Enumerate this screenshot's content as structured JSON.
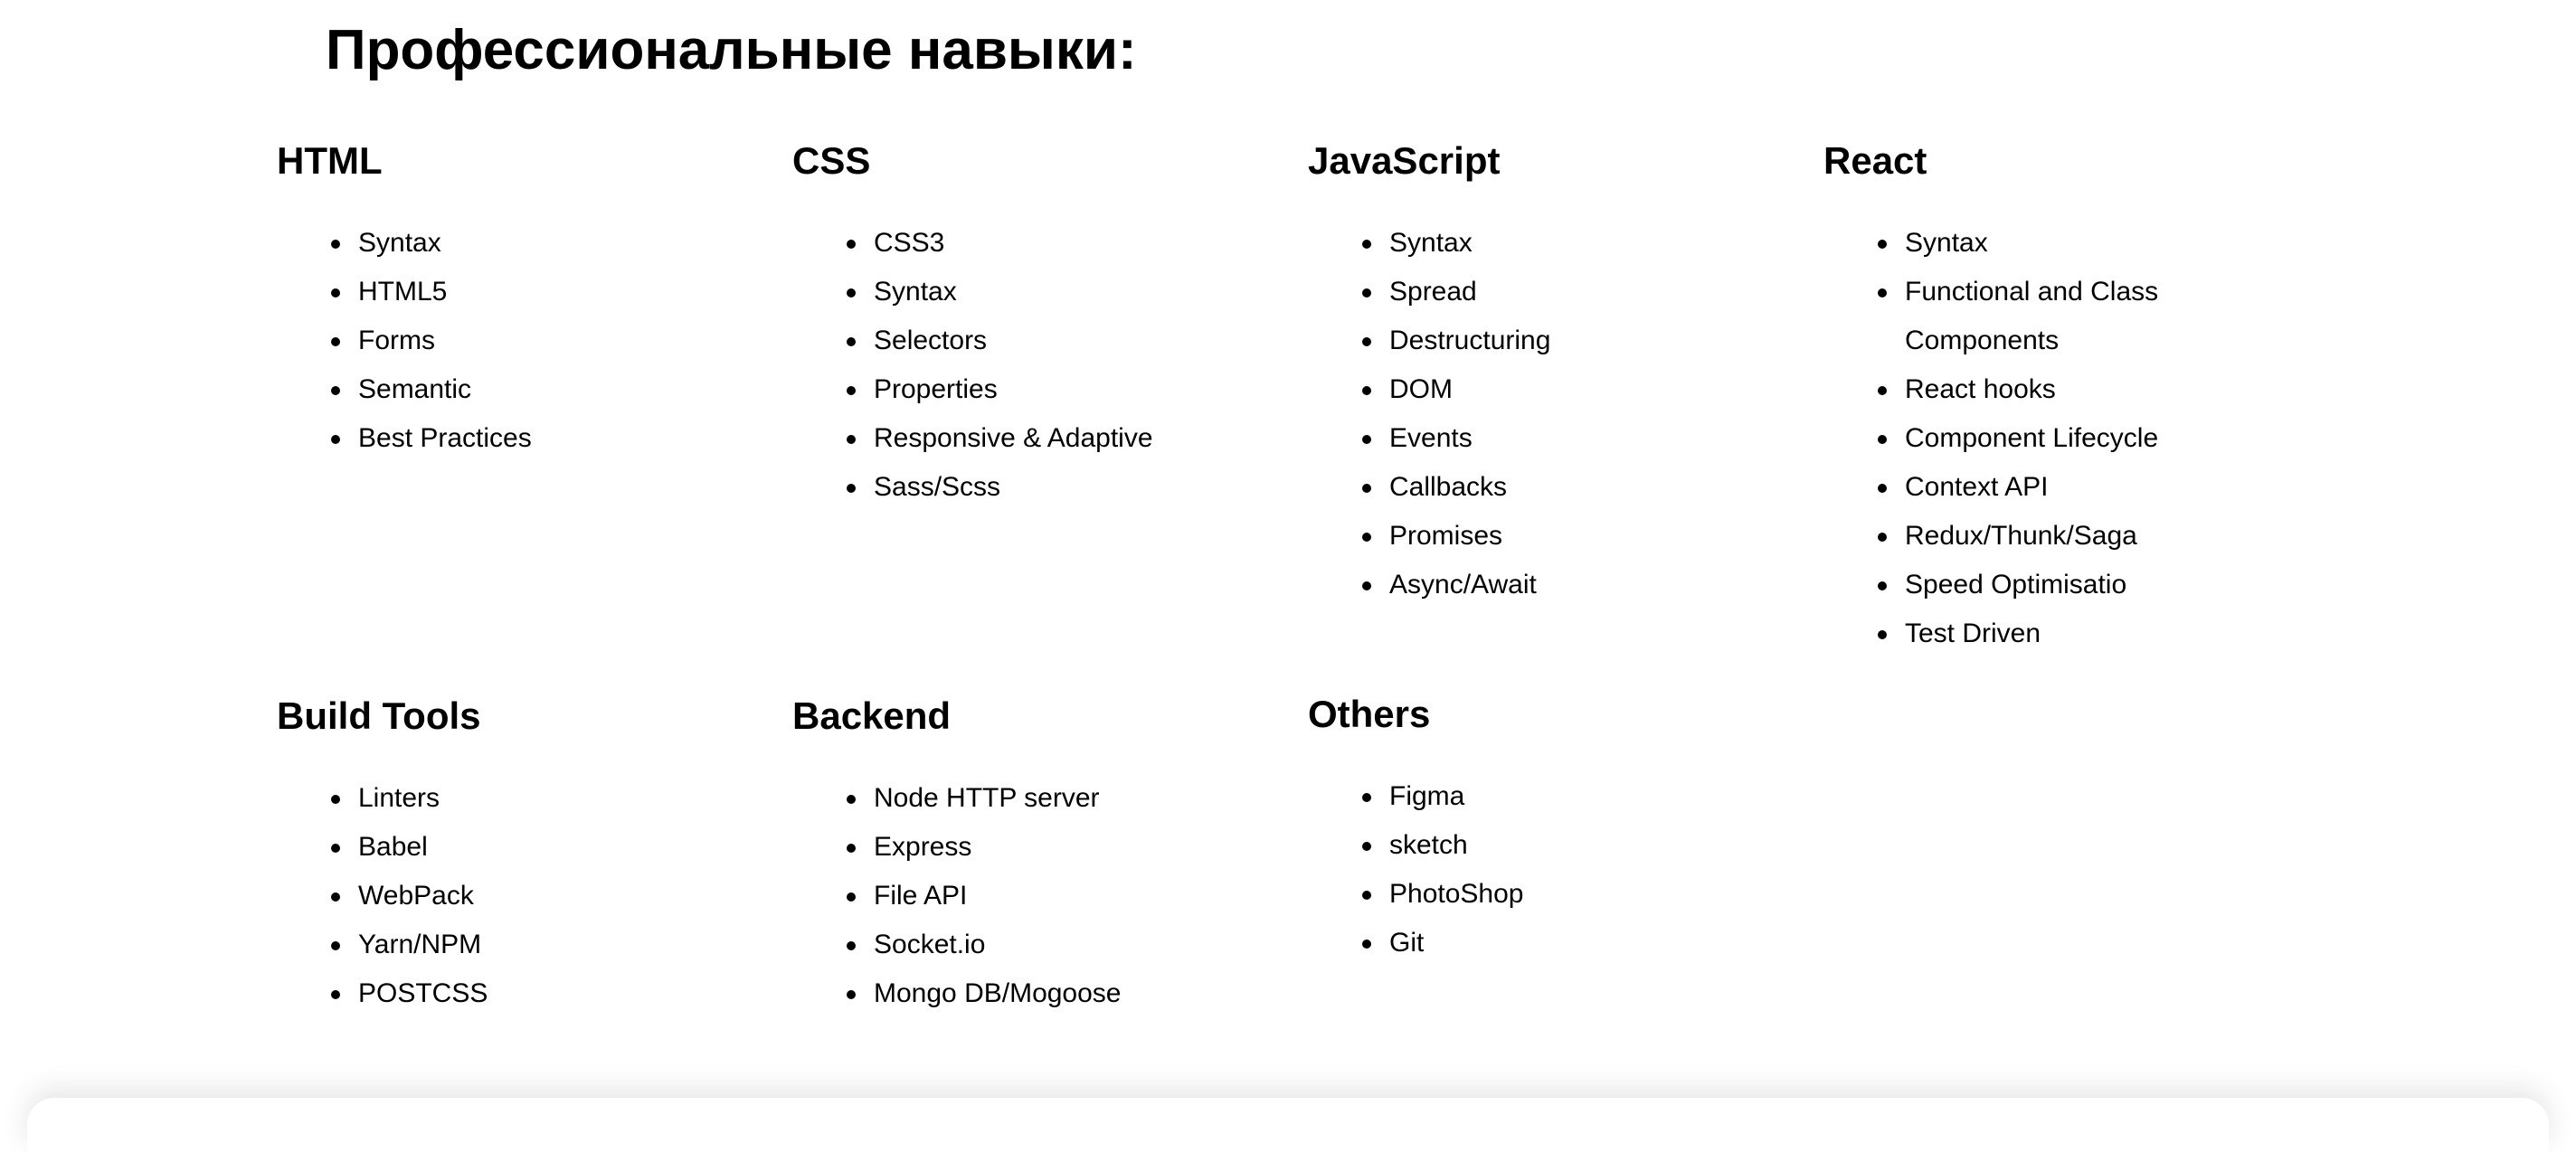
{
  "page": {
    "title": "Профессиональные навыки:"
  },
  "groups": [
    {
      "title": "HTML",
      "items": [
        "Syntax",
        "HTML5",
        "Forms",
        "Semantic",
        "Best Practices"
      ]
    },
    {
      "title": "CSS",
      "items": [
        "CSS3",
        "Syntax",
        "Selectors",
        "Properties",
        "Responsive & Adaptive",
        "Sass/Scss"
      ]
    },
    {
      "title": "JavaScript",
      "items": [
        "Syntax",
        "Spread",
        "Destructuring",
        "DOM",
        "Events",
        "Callbacks",
        "Promises",
        "Async/Await"
      ]
    },
    {
      "title": "React",
      "items": [
        "Syntax",
        "Functional and Class Components",
        "React hooks",
        "Component Lifecycle",
        "Context API",
        "Redux/Thunk/Saga",
        "Speed Optimisatio",
        "Test Driven"
      ]
    },
    {
      "title": "Build Tools",
      "items": [
        "Linters",
        "Babel",
        "WebPack",
        "Yarn/NPM",
        "POSTCSS"
      ]
    },
    {
      "title": "Backend",
      "items": [
        "Node HTTP server",
        "Express",
        "File API",
        "Socket.io",
        "Mongo DB/Mogoose"
      ]
    },
    {
      "title": "Others",
      "items": [
        "Figma",
        "sketch",
        "PhotoShop",
        "Git"
      ]
    }
  ]
}
